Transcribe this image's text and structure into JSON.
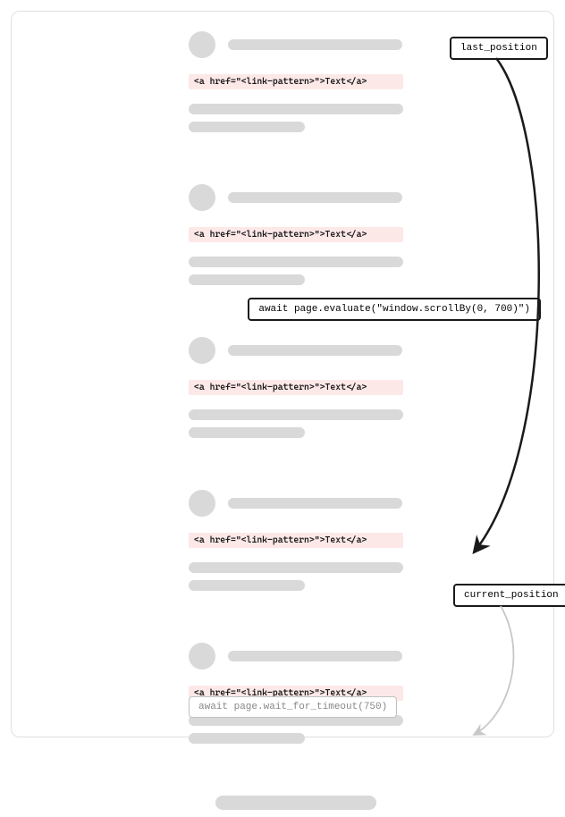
{
  "labels": {
    "last_position": "last_position",
    "scroll_call": "await page.evaluate(\"window.scrollBy(0, 700)\")",
    "current_position": "current_position",
    "wait_call": "await page.wait_for_timeout(750)"
  },
  "link_snippet": "<a href=\"<link-pattern>\">Text</a>",
  "post_count": 5
}
